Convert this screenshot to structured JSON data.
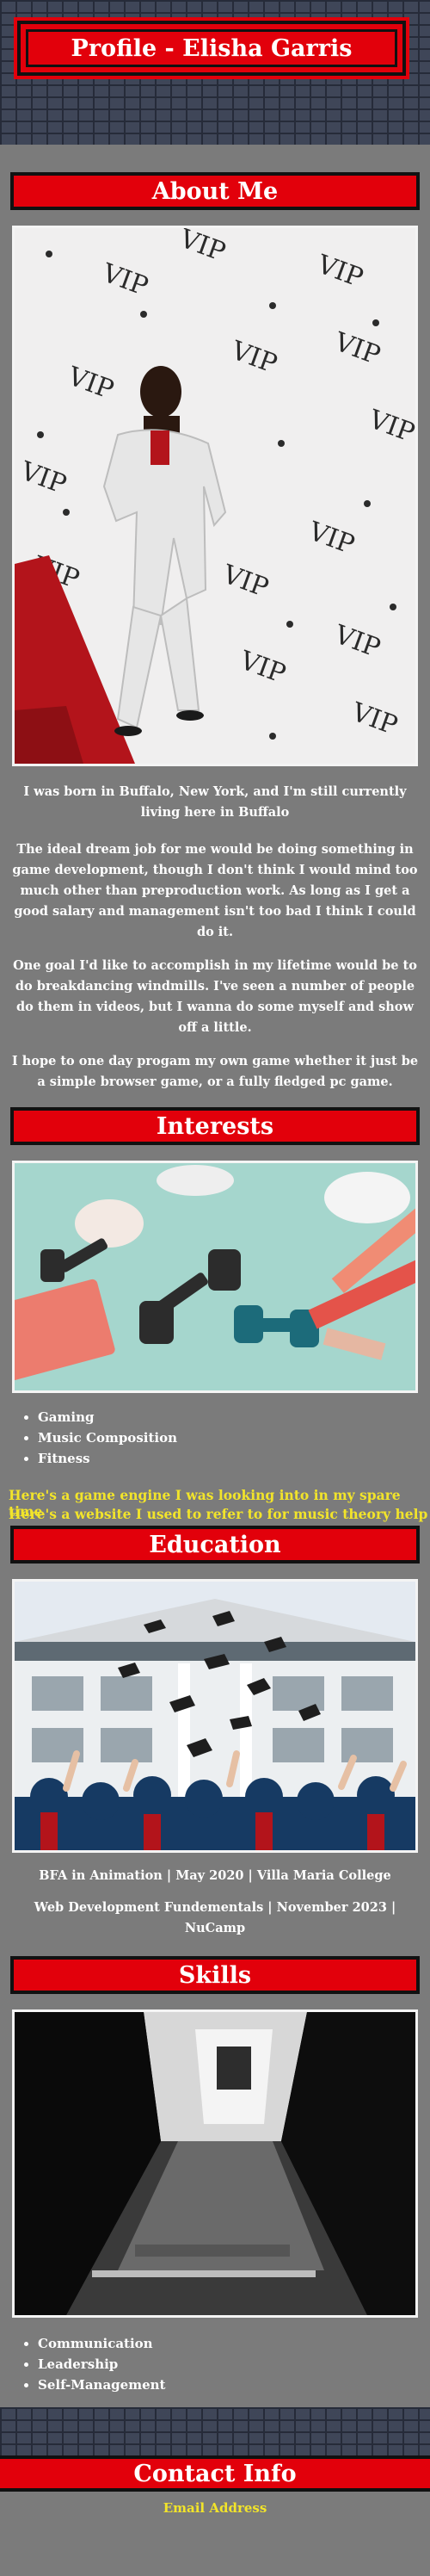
{
  "header": {
    "title": "Profile - Elisha Garris"
  },
  "about": {
    "title": "About Me",
    "paragraphs": [
      "I was born in Buffalo, New York, and I'm still currently living here in Buffalo",
      "The ideal dream job for me would be doing something in game development, though I don't think I would mind too much other than preproduction work. As long as I get a good salary and management isn't too bad I think I could do it.",
      "One goal I'd like to accomplish in my lifetime would be to do breakdancing windmills. I've seen a number of people do them in videos, but I wanna do some myself and show off a little.",
      "I hope to one day progam my own game whether it just be a simple browser game, or a fully fledged pc game."
    ],
    "photo_text": "VIP"
  },
  "interests": {
    "title": "Interests",
    "items": [
      "Gaming",
      "Music Composition",
      "Fitness"
    ],
    "links": [
      "Here's a game engine I was looking into in my spare time",
      "Here's a website I used to refer to for music theory help"
    ]
  },
  "education": {
    "title": "Education",
    "entries": [
      "BFA in Animation | May 2020 | Villa Maria College",
      "Web Development Fundementals | November 2023 | NuCamp"
    ]
  },
  "skills": {
    "title": "Skills",
    "items": [
      "Communication",
      "Leadership",
      "Self-Management"
    ]
  },
  "contact": {
    "title": "Contact Info",
    "email_label": "Email Address"
  },
  "colors": {
    "accent": "#e2000b",
    "page_bg": "#7b7b7b",
    "link": "#f2e42a",
    "brick": "#3f4658"
  }
}
